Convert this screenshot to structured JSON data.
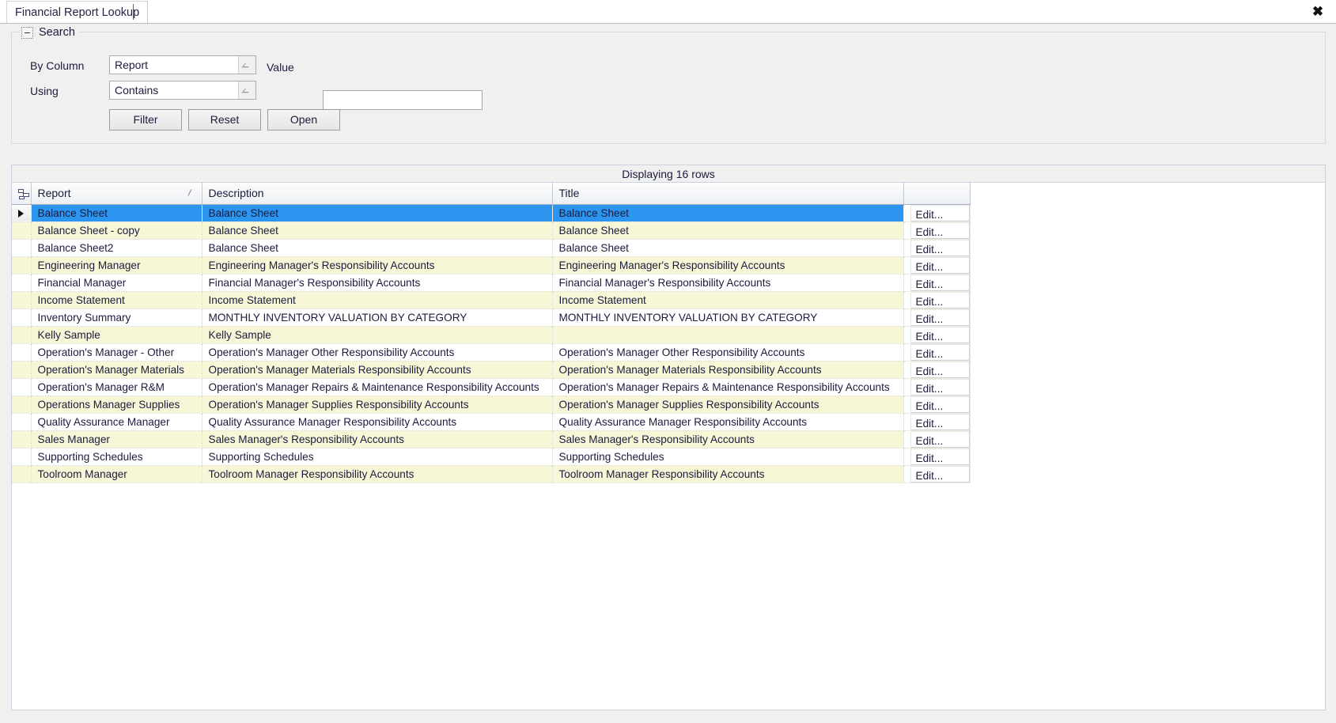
{
  "window": {
    "tab_label": "Financial Report Lookup",
    "close_icon": "close-icon",
    "close_glyph": "✖"
  },
  "search_panel": {
    "title": "Search",
    "collapse_icon": "collapse-box-icon",
    "by_column_label": "By Column",
    "by_column_value": "Report",
    "using_label": "Using",
    "using_value": "Contains",
    "value_label": "Value",
    "value_input": "",
    "value_placeholder": "",
    "buttons": {
      "filter": "Filter",
      "reset": "Reset",
      "open": "Open"
    }
  },
  "grid": {
    "status_text": "Displaying 16 rows",
    "row_count": 16,
    "selected_row_index": 0,
    "sort_column": "Report",
    "sort_direction": "ascending",
    "column_select_icon": "column-chooser-icon",
    "columns": [
      {
        "key": "report",
        "label": "Report"
      },
      {
        "key": "description",
        "label": "Description"
      },
      {
        "key": "title",
        "label": "Title"
      },
      {
        "key": "edit",
        "label": ""
      }
    ],
    "edit_label": "Edit...",
    "accent_selected_bg": "#2b95ef",
    "alt_row_bg": "#f7f7d8",
    "rows": [
      {
        "report": "Balance Sheet",
        "description": "Balance Sheet",
        "title": "Balance Sheet"
      },
      {
        "report": "Balance Sheet - copy",
        "description": "Balance Sheet",
        "title": "Balance Sheet"
      },
      {
        "report": "Balance Sheet2",
        "description": "Balance Sheet",
        "title": "Balance Sheet"
      },
      {
        "report": "Engineering Manager",
        "description": "Engineering Manager's Responsibility Accounts",
        "title": "Engineering Manager's Responsibility Accounts"
      },
      {
        "report": "Financial Manager",
        "description": "Financial Manager's Responsibility Accounts",
        "title": "Financial Manager's Responsibility Accounts"
      },
      {
        "report": "Income Statement",
        "description": "Income Statement",
        "title": "Income Statement"
      },
      {
        "report": "Inventory Summary",
        "description": "MONTHLY INVENTORY VALUATION BY CATEGORY",
        "title": "MONTHLY INVENTORY VALUATION BY CATEGORY"
      },
      {
        "report": "Kelly Sample",
        "description": "Kelly Sample",
        "title": ""
      },
      {
        "report": "Operation's Manager - Other",
        "description": "Operation's Manager Other Responsibility Accounts",
        "title": "Operation's Manager Other Responsibility Accounts"
      },
      {
        "report": "Operation's Manager Materials",
        "description": "Operation's Manager Materials Responsibility Accounts",
        "title": "Operation's Manager Materials Responsibility Accounts"
      },
      {
        "report": "Operation's Manager R&M",
        "description": "Operation's Manager Repairs & Maintenance Responsibility Accounts",
        "title": "Operation's Manager Repairs & Maintenance Responsibility Accounts"
      },
      {
        "report": "Operations Manager Supplies",
        "description": "Operation's Manager Supplies Responsibility Accounts",
        "title": "Operation's Manager Supplies Responsibility Accounts"
      },
      {
        "report": "Quality Assurance Manager",
        "description": "Quality Assurance Manager Responsibility Accounts",
        "title": "Quality Assurance Manager Responsibility Accounts"
      },
      {
        "report": "Sales Manager",
        "description": "Sales Manager's Responsibility Accounts",
        "title": "Sales Manager's Responsibility Accounts"
      },
      {
        "report": "Supporting Schedules",
        "description": "Supporting Schedules",
        "title": "Supporting Schedules"
      },
      {
        "report": "Toolroom Manager",
        "description": "Toolroom Manager Responsibility Accounts",
        "title": "Toolroom Manager Responsibility Accounts"
      }
    ]
  }
}
